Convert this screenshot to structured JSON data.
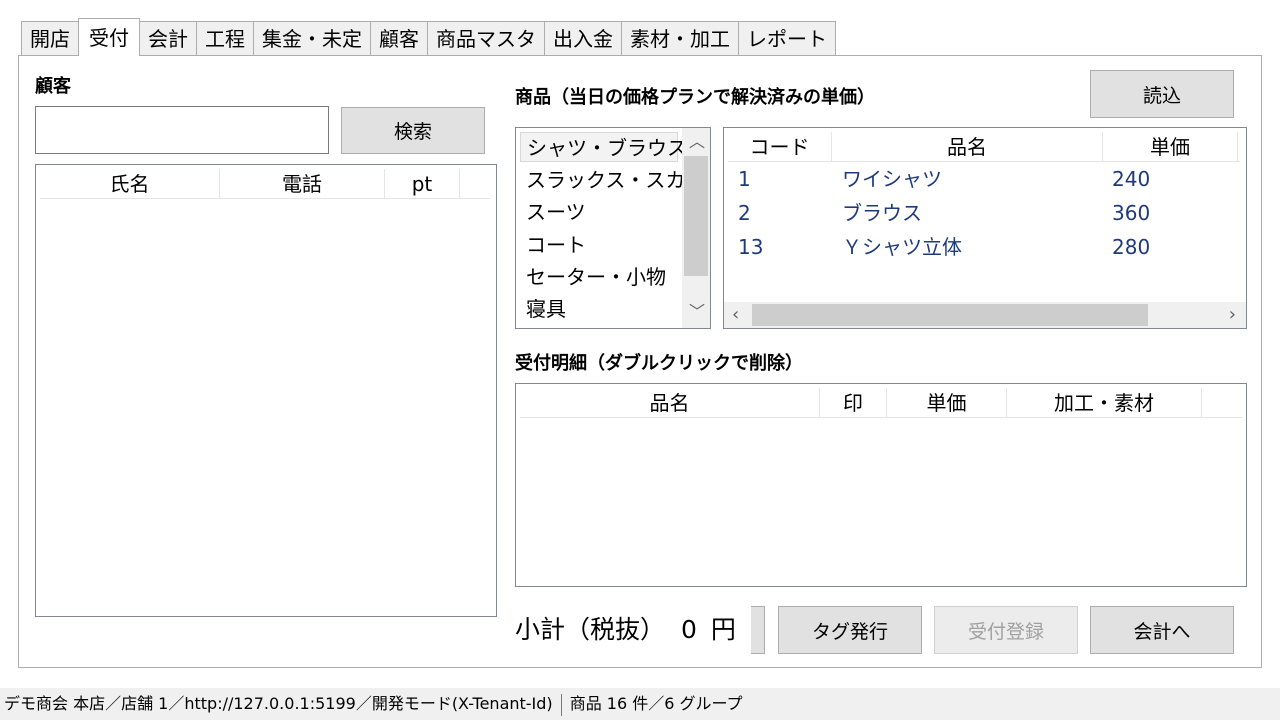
{
  "tabs": [
    {
      "label": "開店"
    },
    {
      "label": "受付"
    },
    {
      "label": "会計"
    },
    {
      "label": "工程"
    },
    {
      "label": "集金・未定"
    },
    {
      "label": "顧客"
    },
    {
      "label": "商品マスタ"
    },
    {
      "label": "出入金"
    },
    {
      "label": "素材・加工"
    },
    {
      "label": "レポート"
    }
  ],
  "active_tab": "受付",
  "customer": {
    "title": "顧客",
    "search_value": "",
    "search_button": "検索",
    "columns": [
      "氏名",
      "電話",
      "pt"
    ],
    "rows": []
  },
  "products": {
    "title": "商品（当日の価格プランで解決済みの単価）",
    "load_button": "読込",
    "groups": [
      "シャツ・ブラウス",
      "スラックス・スカート",
      "スーツ",
      "コート",
      "セーター・小物",
      "寝具"
    ],
    "selected_group": "シャツ・ブラウス",
    "columns": [
      "コード",
      "品名",
      "単価"
    ],
    "rows": [
      {
        "code": "1",
        "name": "ワイシャツ",
        "price": "240"
      },
      {
        "code": "2",
        "name": "ブラウス",
        "price": "360"
      },
      {
        "code": "13",
        "name": "Ｙシャツ立体",
        "price": "280"
      }
    ]
  },
  "details": {
    "title": "受付明細（ダブルクリックで削除）",
    "columns": [
      "品名",
      "印",
      "単価",
      "加工・素材"
    ],
    "rows": []
  },
  "footer": {
    "subtotal_label": "小計（税抜）",
    "subtotal_value": "0",
    "subtotal_unit": "円",
    "tag_button": "タグ発行",
    "register_button": "受付登録",
    "checkout_button": "会計へ"
  },
  "status": {
    "left": "デモ商会 本店／店舗 1／http://127.0.0.1:5199／開発モード(X-Tenant-Id)",
    "right": "商品 16 件／6 グループ"
  }
}
